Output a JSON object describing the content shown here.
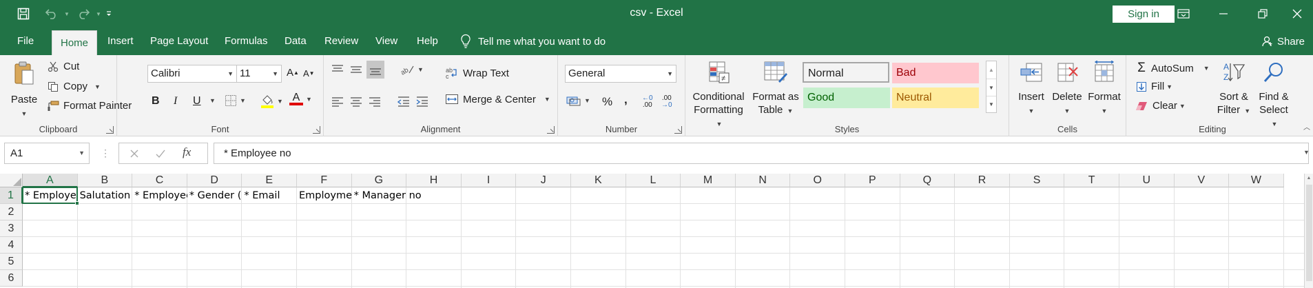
{
  "window": {
    "title": "csv  -  Excel",
    "sign_in": "Sign in"
  },
  "tabs": [
    "File",
    "Home",
    "Insert",
    "Page Layout",
    "Formulas",
    "Data",
    "Review",
    "View",
    "Help"
  ],
  "active_tab": "Home",
  "tell_me": "Tell me what you want to do",
  "share": "Share",
  "ribbon": {
    "clipboard": {
      "label": "Clipboard",
      "paste": "Paste",
      "cut": "Cut",
      "copy": "Copy",
      "format_painter": "Format Painter"
    },
    "font": {
      "label": "Font",
      "font_name": "Calibri",
      "font_size": "11",
      "bold": "B",
      "italic": "I",
      "underline": "U",
      "font_color_glyph": "A"
    },
    "alignment": {
      "label": "Alignment",
      "wrap_text": "Wrap Text",
      "merge_center": "Merge & Center"
    },
    "number": {
      "label": "Number",
      "format": "General",
      "percent": "%",
      "comma": ",",
      "inc_decimal": ".00",
      "dec_decimal": ".00"
    },
    "styles": {
      "label": "Styles",
      "conditional_formatting": [
        "Conditional",
        "Formatting"
      ],
      "format_as_table": [
        "Format as",
        "Table"
      ],
      "cell_styles": [
        {
          "name": "Normal",
          "bg": "#ffffff",
          "fg": "#000000"
        },
        {
          "name": "Bad",
          "bg": "#ffc7ce",
          "fg": "#9c0006"
        },
        {
          "name": "Good",
          "bg": "#c6efce",
          "fg": "#006100"
        },
        {
          "name": "Neutral",
          "bg": "#ffeb9c",
          "fg": "#9c5700"
        }
      ]
    },
    "cells": {
      "label": "Cells",
      "insert": "Insert",
      "delete": "Delete",
      "format": "Format"
    },
    "editing": {
      "label": "Editing",
      "autosum": "AutoSum",
      "fill": "Fill",
      "clear": "Clear",
      "sort_filter": [
        "Sort &",
        "Filter"
      ],
      "find_select": [
        "Find &",
        "Select"
      ]
    }
  },
  "formula_bar": {
    "name_box": "A1",
    "fx": "fx",
    "formula": "* Employee no"
  },
  "sheet": {
    "columns": [
      "A",
      "B",
      "C",
      "D",
      "E",
      "F",
      "G",
      "H",
      "I",
      "J",
      "K",
      "L",
      "M",
      "N",
      "O",
      "P",
      "Q",
      "R",
      "S",
      "T",
      "U",
      "V",
      "W"
    ],
    "rows": [
      "1",
      "2",
      "3",
      "4",
      "5",
      "6"
    ],
    "row1": {
      "A": "* Employee no",
      "B": "Salutation",
      "C": "* Employee name",
      "D": "* Gender (M/F)",
      "E": "* Email",
      "F": "Employment type",
      "G": "* Manager no"
    },
    "selected_cell": "A1"
  },
  "colors": {
    "brand": "#217346",
    "ribbon_bg": "#f3f3f3"
  }
}
